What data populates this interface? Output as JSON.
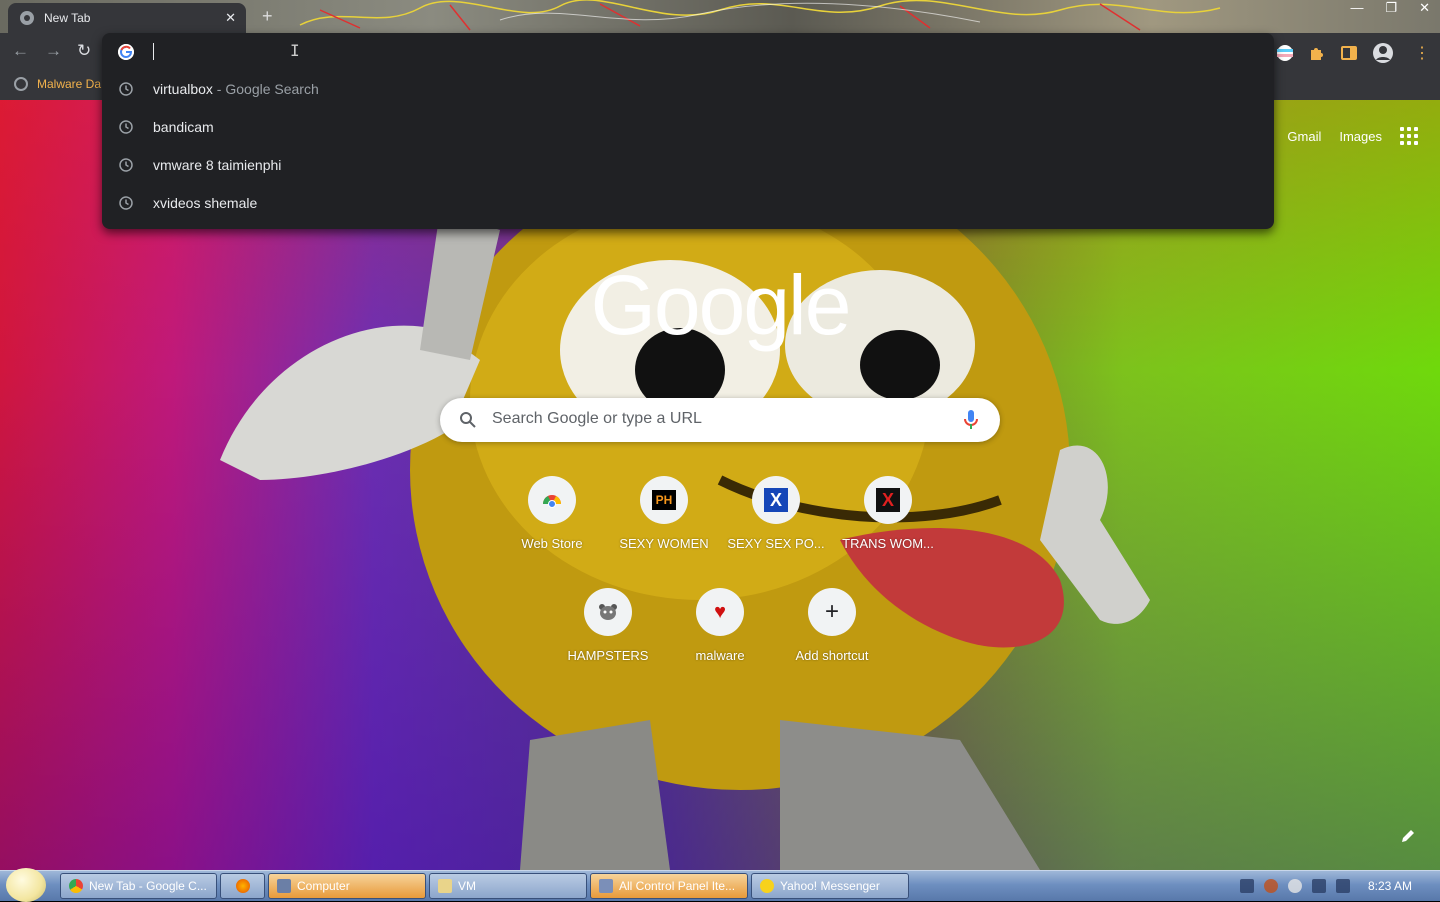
{
  "browser": {
    "tab": {
      "title": "New Tab"
    },
    "bookmarks": [
      {
        "label": "Malware Da"
      }
    ]
  },
  "omnibox": {
    "value": "",
    "suggestions": [
      {
        "text": "virtualbox",
        "sub": " - Google Search"
      },
      {
        "text": "bandicam",
        "sub": ""
      },
      {
        "text": "vmware 8 taimienphi",
        "sub": ""
      },
      {
        "text": "xvideos shemale",
        "sub": ""
      }
    ]
  },
  "ntp": {
    "top_links": {
      "gmail": "Gmail",
      "images": "Images"
    },
    "logo_text": "Google",
    "search_placeholder": "Search Google or type a URL",
    "shortcuts": [
      {
        "label": "Web Store",
        "icon": "chrome-web-store-icon"
      },
      {
        "label": "SEXY WOMEN",
        "icon": "ph-icon",
        "icon_text": "PH"
      },
      {
        "label": "SEXY SEX PO...",
        "icon": "x-blue-icon",
        "icon_text": "X"
      },
      {
        "label": "TRANS WOM...",
        "icon": "x-red-icon",
        "icon_text": "X"
      },
      {
        "label": "HAMPSTERS",
        "icon": "hamster-icon"
      },
      {
        "label": "malware",
        "icon": "heart-icon"
      },
      {
        "label": "Add shortcut",
        "icon": "plus-icon",
        "icon_text": "+"
      }
    ]
  },
  "taskbar": {
    "buttons": [
      {
        "label": "New Tab - Google C..."
      },
      {
        "label": ""
      },
      {
        "label": "Computer"
      },
      {
        "label": "VM"
      },
      {
        "label": "All Control Panel Ite..."
      },
      {
        "label": "Yahoo! Messenger"
      }
    ],
    "clock": "8:23 AM"
  },
  "colors": {
    "toolbar": "#35363a",
    "omnibox_dropdown": "#202124",
    "bookmark_text": "#f2b24c"
  }
}
